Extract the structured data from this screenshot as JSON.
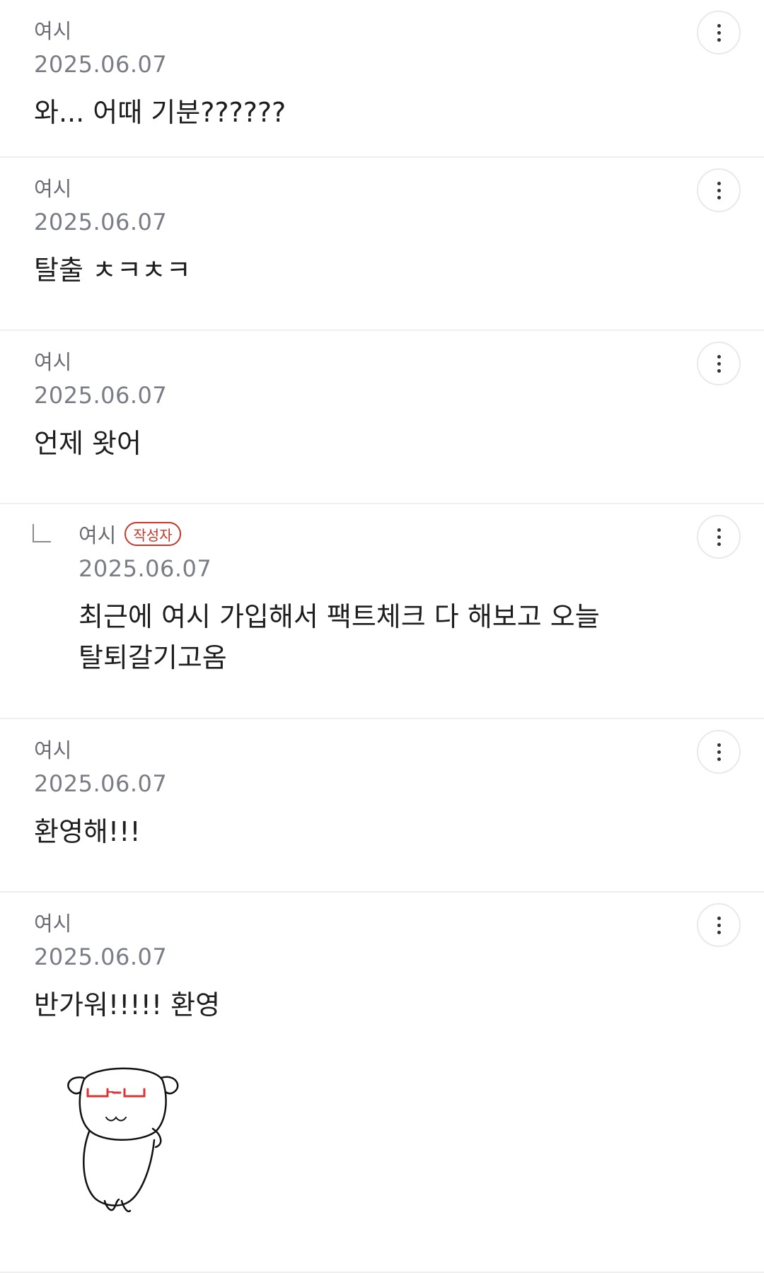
{
  "comments": [
    {
      "author": "여시",
      "date": "2025.06.07",
      "text": "와... 어때 기분??????"
    },
    {
      "author": "여시",
      "date": "2025.06.07",
      "text": "탈출 ㅊㅋㅊㅋ"
    },
    {
      "author": "여시",
      "date": "2025.06.07",
      "text": "언제 왓어"
    },
    {
      "author": "여시",
      "badge": "작성자",
      "date": "2025.06.07",
      "text_line1": "최근에 여시 가입해서 팩트체크 다 해보고 오늘",
      "text_line2": "탈퇴갈기고옴"
    },
    {
      "author": "여시",
      "date": "2025.06.07",
      "text": "환영해!!!"
    },
    {
      "author": "여시",
      "date": "2025.06.07",
      "text": "반가워!!!!! 환영",
      "sticker": "dog-with-glasses-sticker"
    }
  ],
  "icons": {
    "more": "more-vertical-icon",
    "reply": "reply-arrow-icon"
  },
  "colors": {
    "badge": "#c0392b",
    "meta": "#7b7d86",
    "text": "#1e1e1e",
    "divider": "#efefef"
  }
}
